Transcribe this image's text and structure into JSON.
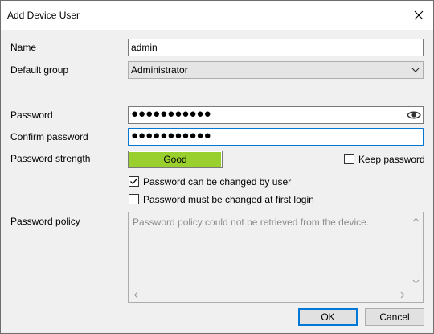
{
  "window": {
    "title": "Add Device User"
  },
  "form": {
    "name_label": "Name",
    "name_value": "admin",
    "group_label": "Default group",
    "group_value": "Administrator",
    "password_label": "Password",
    "password_mask": "●●●●●●●●●●●",
    "confirm_label": "Confirm password",
    "confirm_mask": "●●●●●●●●●●●",
    "strength_label": "Password strength",
    "strength_text": "Good",
    "strength_fraction": 1.0,
    "strength_color": "#99d02e",
    "keep_password_label": "Keep password",
    "keep_password_checked": false,
    "can_change_label": "Password can be changed by user",
    "can_change_checked": true,
    "must_change_label": "Password must be changed at first login",
    "must_change_checked": false,
    "policy_label": "Password policy",
    "policy_text": "Password policy could not be retrieved from the device."
  },
  "buttons": {
    "ok": "OK",
    "cancel": "Cancel"
  },
  "colors": {
    "focus_border": "#0078d7",
    "strength_good": "#99d02e"
  }
}
